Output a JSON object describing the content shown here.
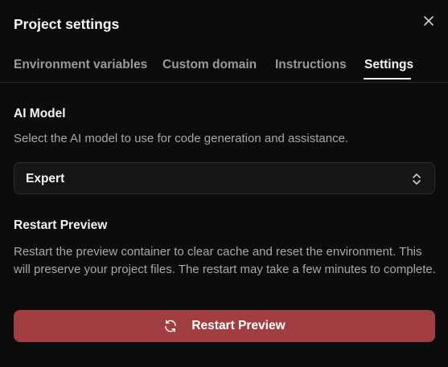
{
  "dialog": {
    "title": "Project settings",
    "close_icon": "close-icon"
  },
  "tabs": [
    {
      "label": "Environment variables",
      "active": false
    },
    {
      "label": "Custom domain",
      "active": false
    },
    {
      "label": "Instructions",
      "active": false
    },
    {
      "label": "Settings",
      "active": true
    }
  ],
  "ai_model": {
    "title": "AI Model",
    "description": "Select the AI model to use for code generation and assistance.",
    "selected_value": "Expert",
    "chevron_icon": "chevron-up-down-icon"
  },
  "restart_preview": {
    "title": "Restart Preview",
    "description": "Restart the preview container to clear cache and reset the environment. This will preserve your project files. The restart may take a few minutes to complete.",
    "button_label": "Restart Preview",
    "button_icon": "refresh-icon"
  },
  "colors": {
    "background": "#0c0c0c",
    "primary_text": "#f4f4f4",
    "muted_text": "#a8a8a8",
    "inactive_tab": "#9a9a9a",
    "border": "#2e2e2e",
    "danger_button": "#a13e42"
  }
}
